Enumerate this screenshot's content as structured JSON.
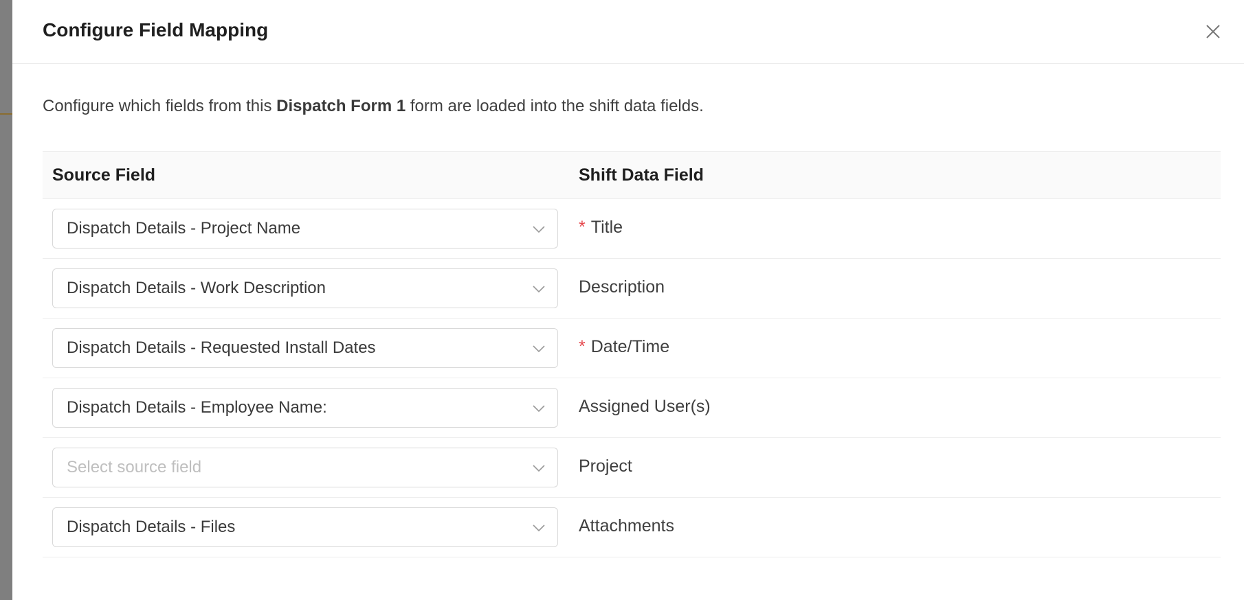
{
  "dialog": {
    "title": "Configure Field Mapping",
    "close_icon": "close-icon",
    "description_prefix": "Configure which fields from this ",
    "description_form_name": "Dispatch Form 1",
    "description_suffix": " form are loaded into the shift data fields."
  },
  "table": {
    "headers": {
      "source": "Source Field",
      "target": "Shift Data Field"
    },
    "rows": [
      {
        "source_value": "Dispatch Details - Project Name",
        "required": "*",
        "target_label": "Title"
      },
      {
        "source_value": "Dispatch Details - Work Description",
        "required": "",
        "target_label": "Description"
      },
      {
        "source_value": "Dispatch Details - Requested Install Dates",
        "required": "*",
        "target_label": "Date/Time"
      },
      {
        "source_value": "Dispatch Details - Employee Name:",
        "required": "",
        "target_label": "Assigned User(s)"
      },
      {
        "source_value": "",
        "source_placeholder": "Select source field",
        "required": "",
        "target_label": "Project"
      },
      {
        "source_value": "Dispatch Details - Files",
        "required": "",
        "target_label": "Attachments"
      }
    ]
  },
  "colors": {
    "required_marker": "#e5484d",
    "border": "#d9d9d9",
    "header_bg": "#fafafa"
  }
}
